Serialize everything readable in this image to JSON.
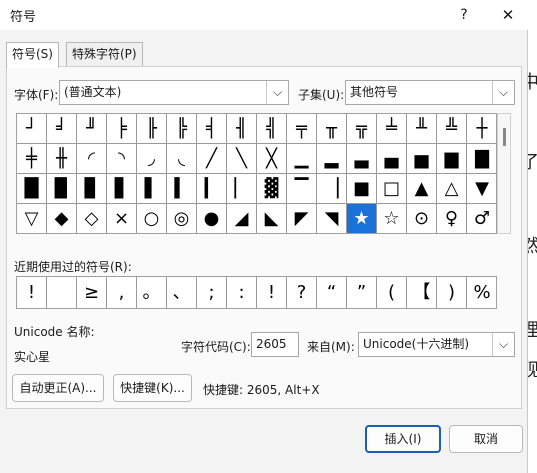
{
  "window": {
    "title": "符号",
    "help_label": "?",
    "close_label": "✕"
  },
  "tabs": [
    {
      "label": "符号(S)"
    },
    {
      "label": "特殊字符(P)"
    }
  ],
  "font": {
    "label": "字体(F):",
    "value": "(普通文本)"
  },
  "subset": {
    "label": "子集(U):",
    "value": "其他符号"
  },
  "symbols": [
    [
      "┘",
      "╛",
      "╜",
      "╞",
      "╟",
      "╠",
      "╡",
      "╢",
      "╣",
      "╤",
      "╥",
      "╦",
      "╧",
      "╨",
      "╩",
      "┼"
    ],
    [
      "╪",
      "╫",
      "◜",
      "◝",
      "◞",
      "◟",
      "╱",
      "╲",
      "╳",
      "▁",
      "▂",
      "▃",
      "▄",
      "▅",
      "▆",
      "▇"
    ],
    [
      "█",
      "▉",
      "▊",
      "▋",
      "▌",
      "▍",
      "▎",
      "▏",
      "▓",
      "▔",
      "▕",
      "■",
      "□",
      "▲",
      "△",
      "▼"
    ],
    [
      "▽",
      "◆",
      "◇",
      "×",
      "○",
      "◎",
      "●",
      "◢",
      "◣",
      "◤",
      "◥",
      "★",
      "☆",
      "⊙",
      "♀",
      "♂"
    ]
  ],
  "selected_symbol": {
    "row": 3,
    "col": 11
  },
  "recent": {
    "label": "近期使用过的符号(R):",
    "items": [
      "!",
      "",
      "≥",
      ",",
      "。",
      "、",
      ";",
      ":",
      "!",
      "?",
      "“",
      "”",
      "(",
      "【",
      ")",
      "%"
    ]
  },
  "unicode_name": {
    "label": "Unicode 名称:",
    "value": "实心星"
  },
  "char_code": {
    "label": "字符代码(C):",
    "value": "2605"
  },
  "from": {
    "label": "来自(M):",
    "value": "Unicode(十六进制)"
  },
  "autocorrect_button": "自动更正(A)...",
  "shortcut_button": "快捷键(K)...",
  "shortcut_text": "快捷键: 2605, Alt+X",
  "insert_button": "插入(I)",
  "cancel_button": "取消",
  "background_text": [
    "中",
    "了",
    "然",
    "理",
    "砚"
  ]
}
